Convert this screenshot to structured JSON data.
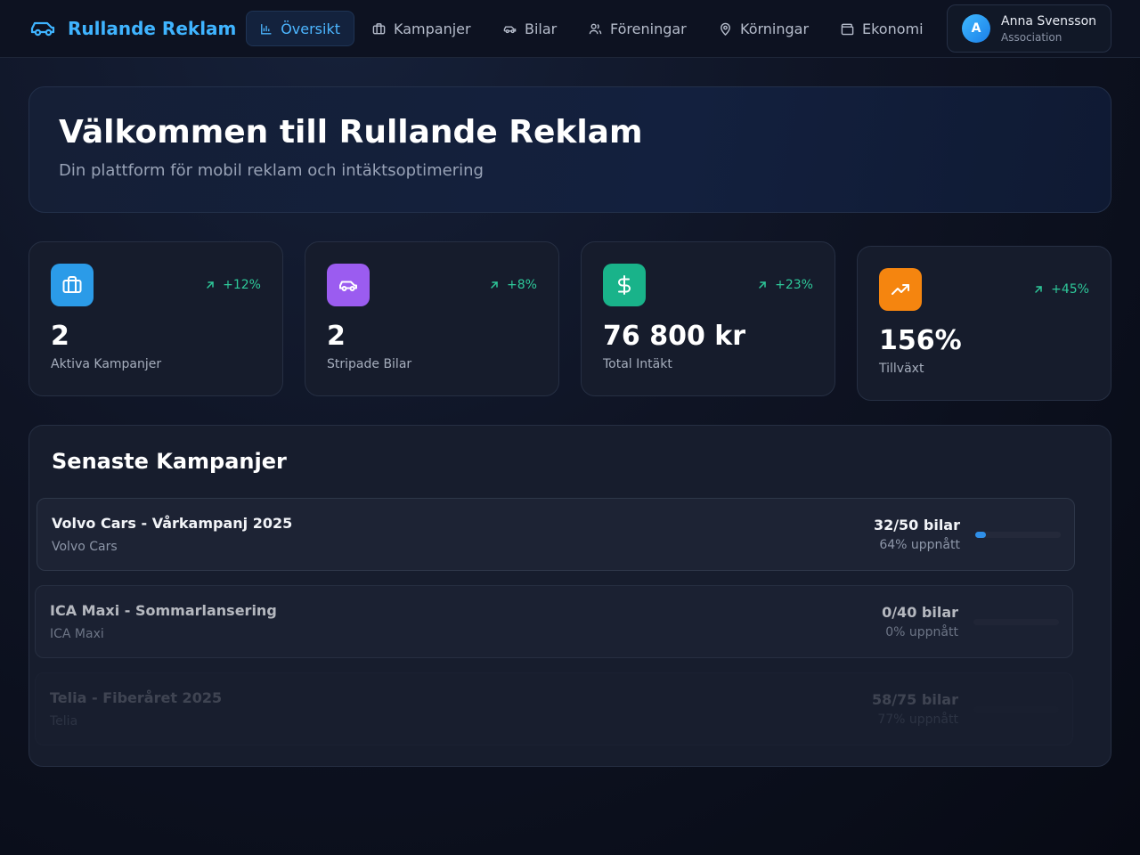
{
  "app": {
    "brand": "Rullande Reklam"
  },
  "nav": {
    "items": [
      {
        "label": "Översikt",
        "icon": "bar-chart-icon",
        "active": true
      },
      {
        "label": "Kampanjer",
        "icon": "briefcase-icon"
      },
      {
        "label": "Bilar",
        "icon": "car-icon"
      },
      {
        "label": "Föreningar",
        "icon": "users-icon"
      },
      {
        "label": "Körningar",
        "icon": "map-pin-icon"
      },
      {
        "label": "Ekonomi",
        "icon": "wallet-icon"
      }
    ]
  },
  "user": {
    "initial": "A",
    "name": "Anna Svensson",
    "role": "Association"
  },
  "hero": {
    "title": "Välkommen till Rullande Reklam",
    "subtitle": "Din plattform för mobil reklam och intäktsoptimering"
  },
  "stats": [
    {
      "value": "2",
      "label": "Aktiva Kampanjer",
      "change": "+12%",
      "icon": "briefcase-icon",
      "color": "#2b9be8"
    },
    {
      "value": "2",
      "label": "Stripade Bilar",
      "change": "+8%",
      "icon": "car-icon",
      "color": "#9b5cf0"
    },
    {
      "value": "76 800 kr",
      "label": "Total Intäkt",
      "change": "+23%",
      "icon": "dollar-icon",
      "color": "#19b38a"
    },
    {
      "value": "156%",
      "label": "Tillväxt",
      "change": "+45%",
      "icon": "trending-up-icon",
      "color": "#f5850f"
    }
  ],
  "campaigns": {
    "title": "Senaste Kampanjer",
    "items": [
      {
        "title": "Volvo Cars - Vårkampanj 2025",
        "company": "Volvo Cars",
        "count": "32/50 bilar",
        "percent_text": "64% uppnått",
        "progress": 0.64
      },
      {
        "title": "ICA Maxi - Sommarlansering",
        "company": "ICA Maxi",
        "count": "0/40 bilar",
        "percent_text": "0% uppnått",
        "progress": 0.0
      },
      {
        "title": "Telia - Fiberåret 2025",
        "company": "Telia",
        "count": "58/75 bilar",
        "percent_text": "77% uppnått",
        "progress": 0.77
      }
    ]
  }
}
